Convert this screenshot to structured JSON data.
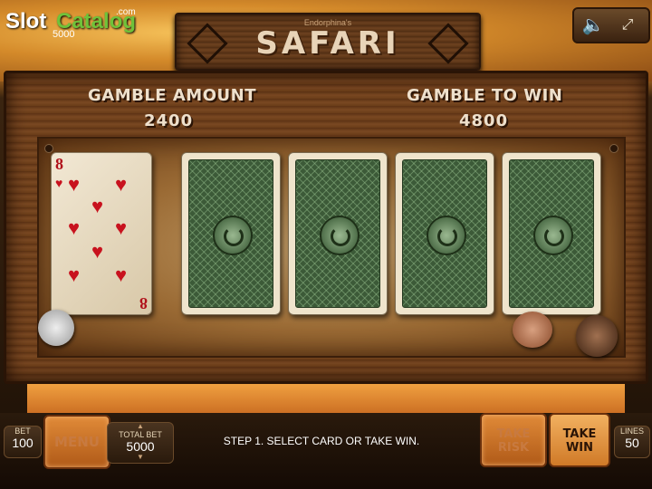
{
  "branding": {
    "slot": "Slot",
    "catalog": "Catalog",
    "com": ".com",
    "sub": "5000"
  },
  "game": {
    "title_pre": "Endorphina's",
    "title": "SAFARI"
  },
  "gamble": {
    "amount_label": "GAMBLE AMOUNT",
    "amount_value": "2400",
    "win_label": "GAMBLE TO WIN",
    "win_value": "4800"
  },
  "cards": {
    "dealer": {
      "rank": "8",
      "suit": "hearts"
    },
    "backs": 4
  },
  "icons": {
    "sound": "speaker-icon",
    "fullscreen": "fullscreen-icon"
  },
  "controls": {
    "bet_label": "BET",
    "bet_value": "100",
    "menu_label": "MENU",
    "total_bet_label": "TOTAL BET",
    "total_bet_value": "5000",
    "take_risk_label": "TAKE RISK",
    "take_win_label": "TAKE WIN",
    "lines_label": "LINES",
    "lines_value": "50"
  },
  "status": "STEP 1. SELECT CARD OR TAKE WIN.",
  "colors": {
    "card_red": "#c8121e",
    "card_back": "#3c5a38",
    "wood": "#6a3c18",
    "accent_orange": "#e08a38"
  }
}
